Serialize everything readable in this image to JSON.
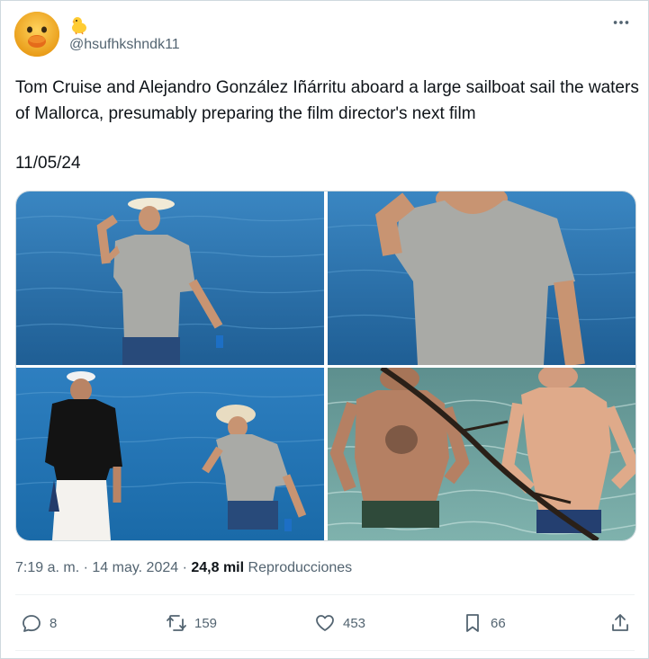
{
  "user": {
    "handle": "@hsufhkshndk11",
    "avatar_icon": "duck-avatar-icon",
    "badge_icon": "chick-emoji-icon"
  },
  "tweet": {
    "text": "Tom Cruise and Alejandro González Iñárritu aboard a large sailboat sail the waters of Mallorca, presumably preparing the film director's next film",
    "date_line": "11/05/24"
  },
  "meta": {
    "timestamp": "7:19 a. m. · 14 may. 2024",
    "separator": " · ",
    "views_count": "24,8 mil",
    "views_label": "Reproducciones"
  },
  "actions": {
    "replies": "8",
    "retweets": "159",
    "likes": "453",
    "bookmarks": "66"
  },
  "colors": {
    "sea": "#2f79b5",
    "text_secondary": "#536471",
    "border": "#cfd9de"
  }
}
